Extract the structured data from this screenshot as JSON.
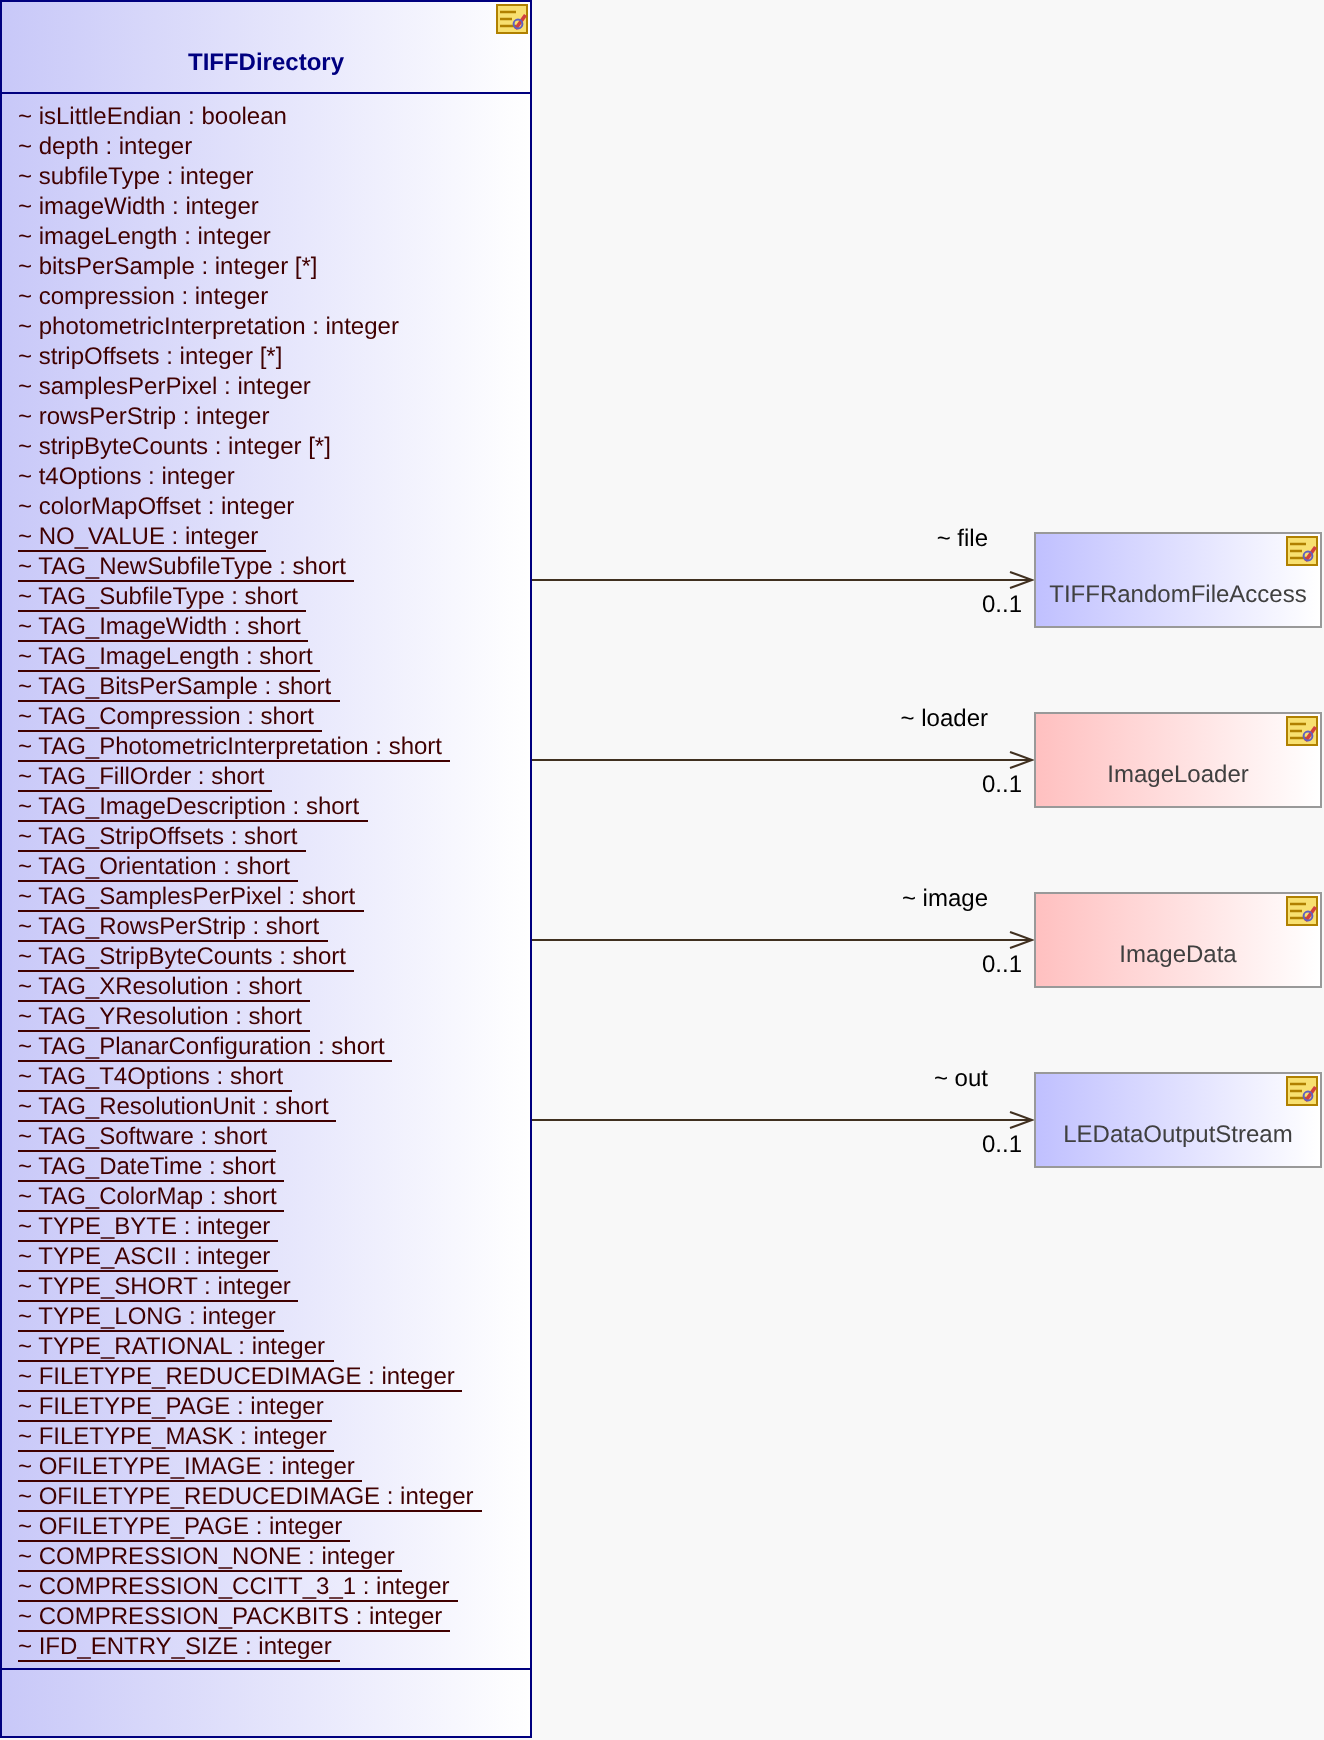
{
  "main_class": {
    "name": "TIFFDirectory",
    "attributes": [
      {
        "text": "~ isLittleEndian : boolean",
        "static": false
      },
      {
        "text": "~ depth : integer",
        "static": false
      },
      {
        "text": "~ subfileType : integer",
        "static": false
      },
      {
        "text": "~ imageWidth : integer",
        "static": false
      },
      {
        "text": "~ imageLength : integer",
        "static": false
      },
      {
        "text": "~ bitsPerSample : integer [*]",
        "static": false
      },
      {
        "text": "~ compression : integer",
        "static": false
      },
      {
        "text": "~ photometricInterpretation : integer",
        "static": false
      },
      {
        "text": "~ stripOffsets : integer [*]",
        "static": false
      },
      {
        "text": "~ samplesPerPixel : integer",
        "static": false
      },
      {
        "text": "~ rowsPerStrip : integer",
        "static": false
      },
      {
        "text": "~ stripByteCounts : integer [*]",
        "static": false
      },
      {
        "text": "~ t4Options : integer",
        "static": false
      },
      {
        "text": "~ colorMapOffset : integer",
        "static": false
      },
      {
        "text": "~ NO_VALUE : integer",
        "static": true
      },
      {
        "text": "~ TAG_NewSubfileType : short",
        "static": true
      },
      {
        "text": "~ TAG_SubfileType : short",
        "static": true
      },
      {
        "text": "~ TAG_ImageWidth : short",
        "static": true
      },
      {
        "text": "~ TAG_ImageLength : short",
        "static": true
      },
      {
        "text": "~ TAG_BitsPerSample : short",
        "static": true
      },
      {
        "text": "~ TAG_Compression : short",
        "static": true
      },
      {
        "text": "~ TAG_PhotometricInterpretation : short",
        "static": true
      },
      {
        "text": "~ TAG_FillOrder : short",
        "static": true
      },
      {
        "text": "~ TAG_ImageDescription : short",
        "static": true
      },
      {
        "text": "~ TAG_StripOffsets : short",
        "static": true
      },
      {
        "text": "~ TAG_Orientation : short",
        "static": true
      },
      {
        "text": "~ TAG_SamplesPerPixel : short",
        "static": true
      },
      {
        "text": "~ TAG_RowsPerStrip : short",
        "static": true
      },
      {
        "text": "~ TAG_StripByteCounts : short",
        "static": true
      },
      {
        "text": "~ TAG_XResolution : short",
        "static": true
      },
      {
        "text": "~ TAG_YResolution : short",
        "static": true
      },
      {
        "text": "~ TAG_PlanarConfiguration : short",
        "static": true
      },
      {
        "text": "~ TAG_T4Options : short",
        "static": true
      },
      {
        "text": "~ TAG_ResolutionUnit : short",
        "static": true
      },
      {
        "text": "~ TAG_Software : short",
        "static": true
      },
      {
        "text": "~ TAG_DateTime : short",
        "static": true
      },
      {
        "text": "~ TAG_ColorMap : short",
        "static": true
      },
      {
        "text": "~ TYPE_BYTE : integer",
        "static": true
      },
      {
        "text": "~ TYPE_ASCII : integer",
        "static": true
      },
      {
        "text": "~ TYPE_SHORT : integer",
        "static": true
      },
      {
        "text": "~ TYPE_LONG : integer",
        "static": true
      },
      {
        "text": "~ TYPE_RATIONAL : integer",
        "static": true
      },
      {
        "text": "~ FILETYPE_REDUCEDIMAGE : integer",
        "static": true
      },
      {
        "text": "~ FILETYPE_PAGE : integer",
        "static": true
      },
      {
        "text": "~ FILETYPE_MASK : integer",
        "static": true
      },
      {
        "text": "~ OFILETYPE_IMAGE : integer",
        "static": true
      },
      {
        "text": "~ OFILETYPE_REDUCEDIMAGE : integer",
        "static": true
      },
      {
        "text": "~ OFILETYPE_PAGE : integer",
        "static": true
      },
      {
        "text": "~ COMPRESSION_NONE : integer",
        "static": true
      },
      {
        "text": "~ COMPRESSION_CCITT_3_1 : integer",
        "static": true
      },
      {
        "text": "~ COMPRESSION_PACKBITS : integer",
        "static": true
      },
      {
        "text": "~ IFD_ENTRY_SIZE : integer",
        "static": true
      }
    ]
  },
  "associations": [
    {
      "role": "~ file",
      "multiplicity": "0..1",
      "target": {
        "name": "TIFFRandomFileAccess",
        "color": "#c0c0ff"
      }
    },
    {
      "role": "~ loader",
      "multiplicity": "0..1",
      "target": {
        "name": "ImageLoader",
        "color": "#ffc0c0"
      }
    },
    {
      "role": "~ image",
      "multiplicity": "0..1",
      "target": {
        "name": "ImageData",
        "color": "#ffc0c0"
      }
    },
    {
      "role": "~ out",
      "multiplicity": "0..1",
      "target": {
        "name": "LEDataOutputStream",
        "color": "#c0c0ff"
      }
    }
  ]
}
